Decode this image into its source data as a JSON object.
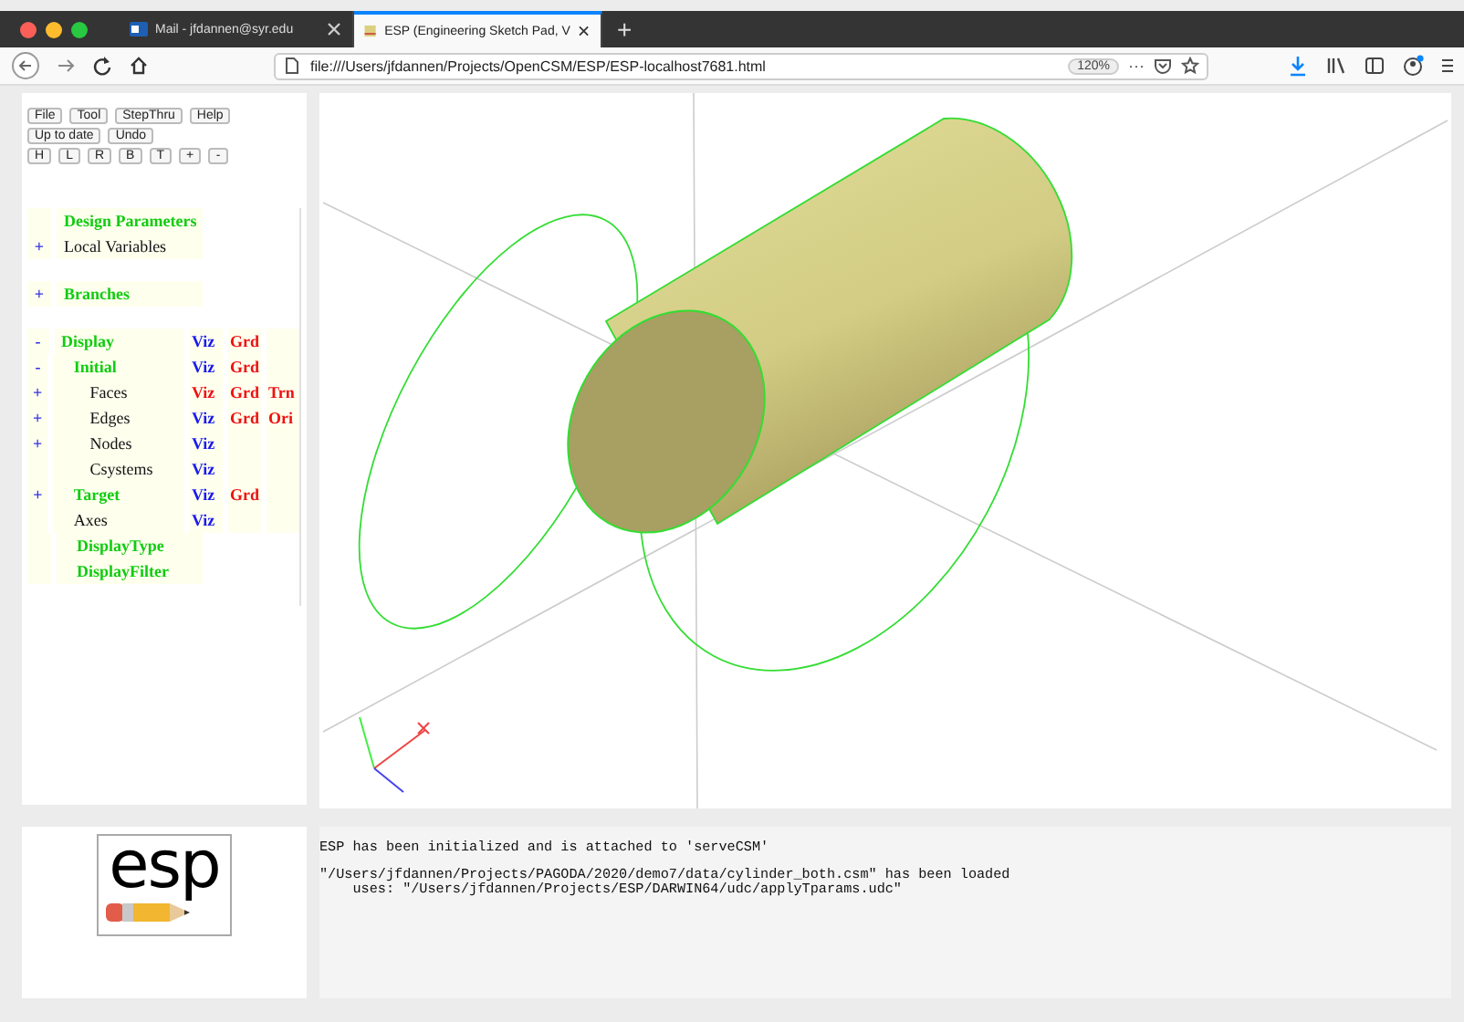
{
  "browser": {
    "tabs": [
      {
        "title": "Mail - jfdannen@syr.edu",
        "selected": false
      },
      {
        "title": "ESP (Engineering Sketch Pad, V",
        "selected": true
      }
    ],
    "new_tab": "+",
    "address": "file:///Users/jfdannen/Projects/OpenCSM/ESP/ESP-localhost7681.html",
    "zoom": "120%",
    "more": "···"
  },
  "toolbar": {
    "menu": [
      "File",
      "Tool",
      "StepThru",
      "Help"
    ],
    "history": [
      "Up to date",
      "Undo"
    ],
    "views": [
      "H",
      "L",
      "R",
      "B",
      "T",
      "+",
      "-"
    ]
  },
  "tree": [
    {
      "items": [
        {
          "label": "Design Parameters",
          "kind": "header"
        },
        {
          "toggle": "+",
          "label": "Local Variables",
          "kind": "item"
        }
      ]
    },
    {
      "items": [
        {
          "toggle": "+",
          "label": "Branches",
          "kind": "header"
        }
      ]
    },
    {
      "items": [
        {
          "toggle": "-",
          "label": "Display",
          "kind": "header",
          "actions": [
            {
              "text": "Viz",
              "color": "#1a1aee"
            },
            {
              "text": "Grd",
              "color": "#ee1111"
            }
          ],
          "children": [
            {
              "toggle": "-",
              "label": "Initial",
              "kind": "header",
              "actions": [
                {
                  "text": "Viz",
                  "color": "#1a1aee"
                },
                {
                  "text": "Grd",
                  "color": "#ee1111"
                }
              ],
              "children": [
                {
                  "toggle": "+",
                  "label": "Faces",
                  "kind": "item",
                  "actions": [
                    {
                      "text": "Viz",
                      "color": "#ee1111"
                    },
                    {
                      "text": "Grd",
                      "color": "#ee1111"
                    },
                    {
                      "text": "Trn",
                      "color": "#ee1111"
                    }
                  ]
                },
                {
                  "toggle": "+",
                  "label": "Edges",
                  "kind": "item",
                  "actions": [
                    {
                      "text": "Viz",
                      "color": "#1a1aee"
                    },
                    {
                      "text": "Grd",
                      "color": "#ee1111"
                    },
                    {
                      "text": "Ori",
                      "color": "#ee1111"
                    }
                  ]
                },
                {
                  "toggle": "+",
                  "label": "Nodes",
                  "kind": "item",
                  "actions": [
                    {
                      "text": "Viz",
                      "color": "#1a1aee"
                    }
                  ]
                },
                {
                  "label": "Csystems",
                  "kind": "item",
                  "actions": [
                    {
                      "text": "Viz",
                      "color": "#1a1aee"
                    }
                  ]
                }
              ]
            },
            {
              "toggle": "+",
              "label": "Target",
              "kind": "header",
              "actions": [
                {
                  "text": "Viz",
                  "color": "#1a1aee"
                },
                {
                  "text": "Grd",
                  "color": "#ee1111"
                }
              ]
            },
            {
              "label": "Axes",
              "kind": "item",
              "actions": [
                {
                  "text": "Viz",
                  "color": "#1a1aee"
                }
              ]
            },
            {
              "label": "DisplayType",
              "kind": "header"
            },
            {
              "label": "DisplayFilter",
              "kind": "header"
            }
          ]
        }
      ]
    }
  ],
  "logo": {
    "text": "esp"
  },
  "messages": [
    "ESP has been initialized and is attached to 'serveCSM'",
    "\"/Users/jfdannen/Projects/PAGODA/2020/demo7/data/cylinder_both.csm\" has been loaded\n    uses: \"/Users/jfdannen/Projects/ESP/DARWIN64/udc/applyTparams.udc\""
  ]
}
